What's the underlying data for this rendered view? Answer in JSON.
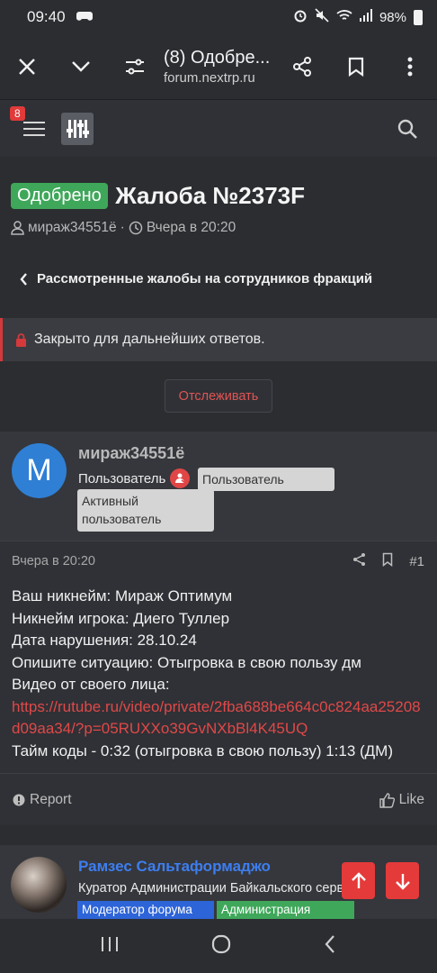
{
  "status_bar": {
    "time": "09:40",
    "battery": "98%"
  },
  "browser": {
    "page_title": "(8) Одобре...",
    "url": "forum.nextrp.ru"
  },
  "forum_header": {
    "notification_count": "8"
  },
  "thread": {
    "status": "Одобрено",
    "title": "Жалоба №2373F",
    "author": "мираж34551ё",
    "separator": "·",
    "date": "Вчера в 20:20",
    "breadcrumb": "Рассмотренные жалобы на сотрудников фракций",
    "locked_notice": "Закрыто для дальнейших ответов.",
    "watch_label": "Отслеживать"
  },
  "post1": {
    "avatar_letter": "M",
    "username": "мираж34551ё",
    "user_title": "Пользователь",
    "banners": [
      "Пользователь",
      "Активный пользователь"
    ],
    "date": "Вчера в 20:20",
    "post_number": "#1",
    "lines": [
      "Ваш никнейм: Мираж Оптимум",
      "Никнейм игрока: Диего Туллер",
      "Дата нарушения: 28.10.24",
      "Опишите ситуацию: Отыгровка в свою пользу дм",
      "Видео от своего лица:"
    ],
    "link": "https://rutube.ru/video/private/2fba688be664c0c824aa25208d09aa34/?p=05RUXXo39GvNXbBl4K45UQ",
    "last_line": "Тайм коды - 0:32 (отыгровка в свою пользу) 1:13 (ДМ)",
    "report_label": "Report",
    "like_label": "Like"
  },
  "post2": {
    "username": "Рамзес Сальтаформаджо",
    "user_title": "Куратор Администрации Байкальского сервера",
    "banners": [
      "Модератор форума",
      "Администрация"
    ]
  },
  "colors": {
    "approved": "#3fa75a",
    "accent_red": "#e04848",
    "link_blue": "#3d7ef0",
    "moderator_blue": "#2d64d8"
  }
}
